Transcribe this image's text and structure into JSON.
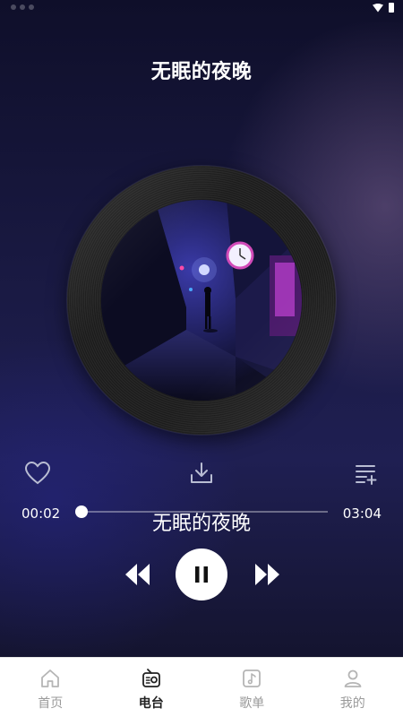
{
  "song": {
    "title": "无眠的夜晚",
    "lyric": "无眠的夜晚"
  },
  "progress": {
    "current": "00:02",
    "total": "03:04",
    "fraction": 0.01
  },
  "actions": {
    "like_icon": "heart-icon",
    "download_icon": "download-icon",
    "playlist_icon": "playlist-add-icon"
  },
  "controls": {
    "previous_icon": "rewind-icon",
    "play_state": "playing",
    "pause_icon": "pause-icon",
    "next_icon": "fast-forward-icon"
  },
  "tabbar": {
    "items": [
      {
        "label": "首页",
        "icon": "home-icon",
        "active": false
      },
      {
        "label": "电台",
        "icon": "radio-icon",
        "active": true
      },
      {
        "label": "歌单",
        "icon": "music-note-icon",
        "active": false
      },
      {
        "label": "我的",
        "icon": "user-icon",
        "active": false
      }
    ]
  },
  "colors": {
    "accent": "#ffffff",
    "tab_active": "#222222",
    "tab_inactive": "#9a9a9a",
    "background_top": "#0f0f2a",
    "background_mid": "#1f1f52"
  }
}
